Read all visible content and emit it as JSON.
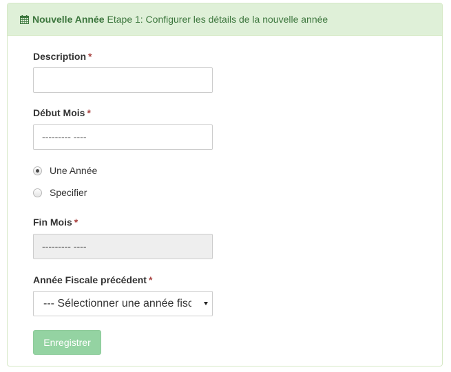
{
  "panel": {
    "title": "Nouvelle Année",
    "subtitle": "Etape 1: Configurer les détails de la nouvelle année",
    "icon": "calendar-icon"
  },
  "form": {
    "description": {
      "label": "Description",
      "required": "*",
      "value": ""
    },
    "start_month": {
      "label": "Début Mois",
      "required": "*",
      "value": "--------- ----"
    },
    "period_options": [
      {
        "label": "Une Année",
        "checked": true
      },
      {
        "label": "Specifier",
        "checked": false
      }
    ],
    "end_month": {
      "label": "Fin Mois",
      "required": "*",
      "value": "--------- ----"
    },
    "previous_fiscal_year": {
      "label": "Année Fiscale précédent",
      "required": "*",
      "selected": "--- Sélectionner une année fiscale ---"
    },
    "save_label": "Enregistrer"
  },
  "colors": {
    "heading_bg": "#dff0d8",
    "heading_text": "#3c763d",
    "required": "#a94442",
    "button_bg": "#8fd19e"
  }
}
